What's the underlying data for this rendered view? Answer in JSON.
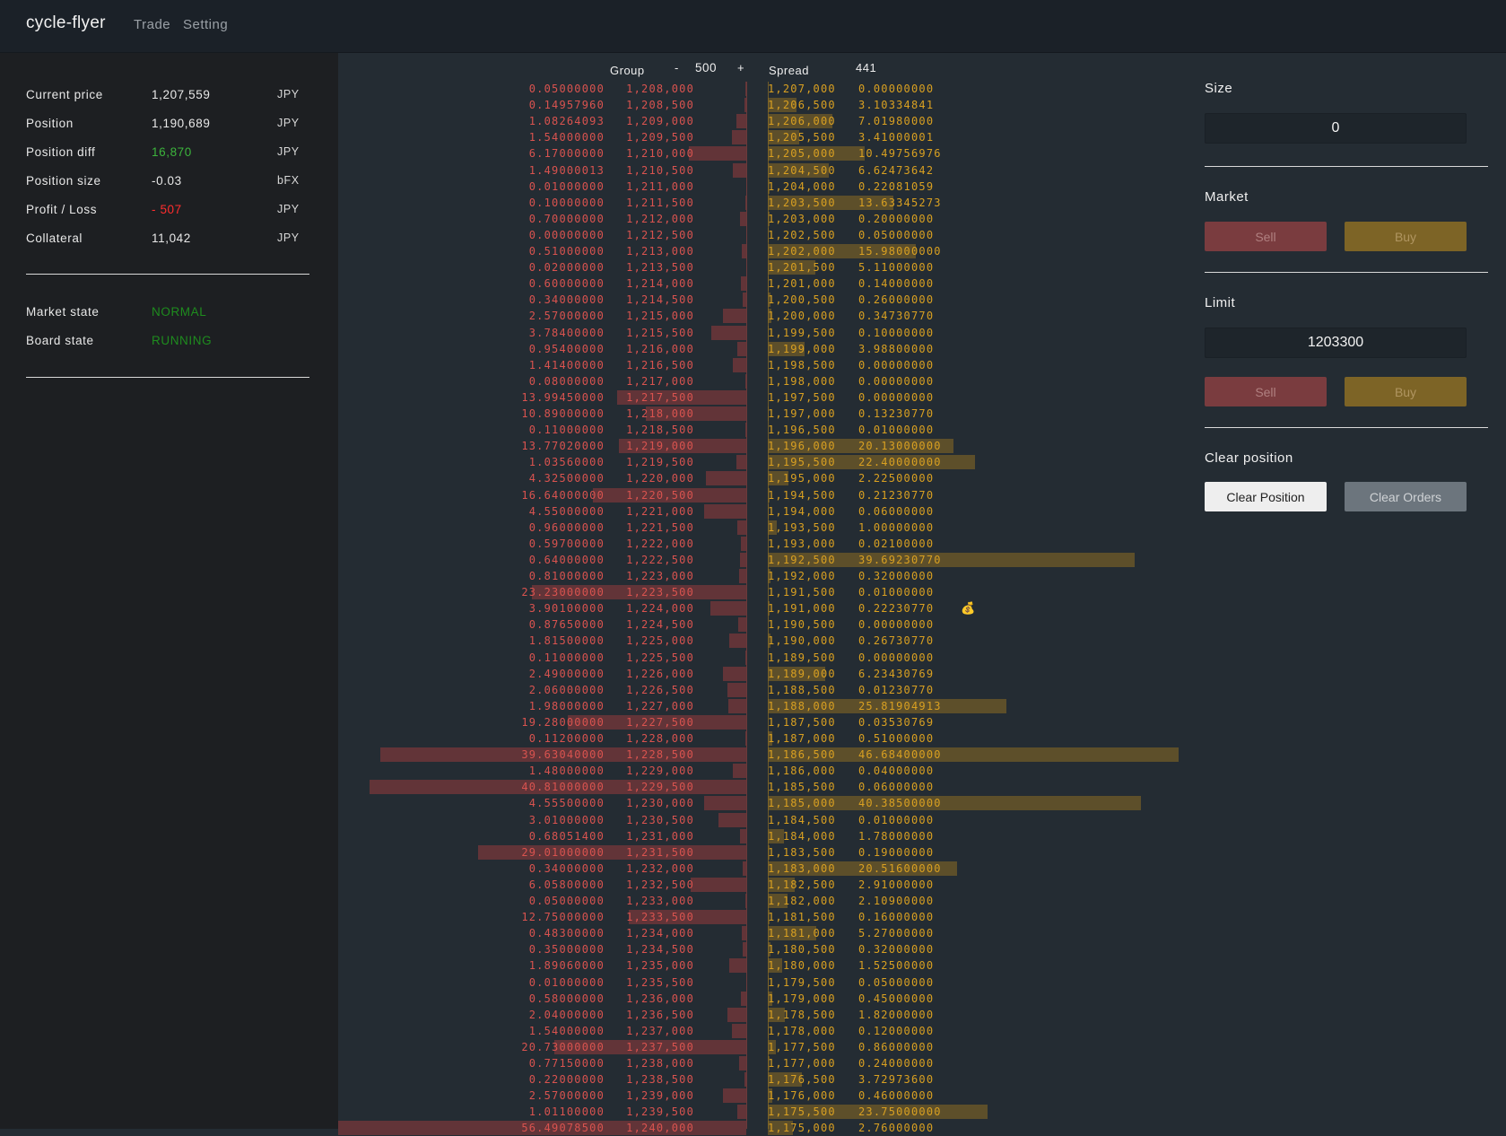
{
  "app": {
    "brand": "cycle-flyer",
    "nav": [
      "Trade",
      "Setting"
    ]
  },
  "colors": {
    "ask": "#d9534f",
    "bid": "#d9a021",
    "positive": "#3cb43c",
    "negative": "#ff2d2d"
  },
  "summary": [
    {
      "label": "Current price",
      "value": "1,207,559",
      "unit": "JPY"
    },
    {
      "label": "Position",
      "value": "1,190,689",
      "unit": "JPY"
    },
    {
      "label": "Position diff",
      "value": "16,870",
      "unit": "JPY",
      "tone": "positive"
    },
    {
      "label": "Position size",
      "value": "-0.03",
      "unit": "bFX"
    },
    {
      "label": "Profit / Loss",
      "value": "- 507",
      "unit": "JPY",
      "tone": "negative"
    },
    {
      "label": "Collateral",
      "value": "11,042",
      "unit": "JPY"
    }
  ],
  "states": [
    {
      "label": "Market state",
      "value": "NORMAL"
    },
    {
      "label": "Board state",
      "value": "RUNNING"
    }
  ],
  "board": {
    "group_label": "Group",
    "minus": "-",
    "group_value": "500",
    "plus": "+",
    "spread_label": "Spread",
    "spread_value": "441",
    "position_marker_icon": "money-bag-icon",
    "position_marker_glyph": "💰",
    "asks": [
      {
        "size": "0.05000000",
        "price": "1,208,000"
      },
      {
        "size": "0.14957960",
        "price": "1,208,500"
      },
      {
        "size": "1.08264093",
        "price": "1,209,000"
      },
      {
        "size": "1.54000000",
        "price": "1,209,500"
      },
      {
        "size": "6.17000000",
        "price": "1,210,000"
      },
      {
        "size": "1.49000013",
        "price": "1,210,500"
      },
      {
        "size": "0.01000000",
        "price": "1,211,000"
      },
      {
        "size": "0.10000000",
        "price": "1,211,500"
      },
      {
        "size": "0.70000000",
        "price": "1,212,000"
      },
      {
        "size": "0.00000000",
        "price": "1,212,500"
      },
      {
        "size": "0.51000000",
        "price": "1,213,000"
      },
      {
        "size": "0.02000000",
        "price": "1,213,500"
      },
      {
        "size": "0.60000000",
        "price": "1,214,000"
      },
      {
        "size": "0.34000000",
        "price": "1,214,500"
      },
      {
        "size": "2.57000000",
        "price": "1,215,000"
      },
      {
        "size": "3.78400000",
        "price": "1,215,500"
      },
      {
        "size": "0.95400000",
        "price": "1,216,000"
      },
      {
        "size": "1.41400000",
        "price": "1,216,500"
      },
      {
        "size": "0.08000000",
        "price": "1,217,000"
      },
      {
        "size": "13.99450000",
        "price": "1,217,500"
      },
      {
        "size": "10.89000000",
        "price": "1,218,000"
      },
      {
        "size": "0.11000000",
        "price": "1,218,500"
      },
      {
        "size": "13.77020000",
        "price": "1,219,000"
      },
      {
        "size": "1.03560000",
        "price": "1,219,500"
      },
      {
        "size": "4.32500000",
        "price": "1,220,000"
      },
      {
        "size": "16.64000000",
        "price": "1,220,500"
      },
      {
        "size": "4.55000000",
        "price": "1,221,000"
      },
      {
        "size": "0.96000000",
        "price": "1,221,500"
      },
      {
        "size": "0.59700000",
        "price": "1,222,000"
      },
      {
        "size": "0.64000000",
        "price": "1,222,500"
      },
      {
        "size": "0.81000000",
        "price": "1,223,000"
      },
      {
        "size": "23.23000000",
        "price": "1,223,500"
      },
      {
        "size": "3.90100000",
        "price": "1,224,000"
      },
      {
        "size": "0.87650000",
        "price": "1,224,500"
      },
      {
        "size": "1.81500000",
        "price": "1,225,000"
      },
      {
        "size": "0.11000000",
        "price": "1,225,500"
      },
      {
        "size": "2.49000000",
        "price": "1,226,000"
      },
      {
        "size": "2.06000000",
        "price": "1,226,500"
      },
      {
        "size": "1.98000000",
        "price": "1,227,000"
      },
      {
        "size": "19.28000000",
        "price": "1,227,500"
      },
      {
        "size": "0.11200000",
        "price": "1,228,000"
      },
      {
        "size": "39.63040000",
        "price": "1,228,500"
      },
      {
        "size": "1.48000000",
        "price": "1,229,000"
      },
      {
        "size": "40.81000000",
        "price": "1,229,500"
      },
      {
        "size": "4.55500000",
        "price": "1,230,000"
      },
      {
        "size": "3.01000000",
        "price": "1,230,500"
      },
      {
        "size": "0.68051400",
        "price": "1,231,000"
      },
      {
        "size": "29.01000000",
        "price": "1,231,500"
      },
      {
        "size": "0.34000000",
        "price": "1,232,000"
      },
      {
        "size": "6.05800000",
        "price": "1,232,500"
      },
      {
        "size": "0.05000000",
        "price": "1,233,000"
      },
      {
        "size": "12.75000000",
        "price": "1,233,500"
      },
      {
        "size": "0.48300000",
        "price": "1,234,000"
      },
      {
        "size": "0.35000000",
        "price": "1,234,500"
      },
      {
        "size": "1.89060000",
        "price": "1,235,000"
      },
      {
        "size": "0.01000000",
        "price": "1,235,500"
      },
      {
        "size": "0.58000000",
        "price": "1,236,000"
      },
      {
        "size": "2.04000000",
        "price": "1,236,500"
      },
      {
        "size": "1.54000000",
        "price": "1,237,000"
      },
      {
        "size": "20.73000000",
        "price": "1,237,500"
      },
      {
        "size": "0.77150000",
        "price": "1,238,000"
      },
      {
        "size": "0.22000000",
        "price": "1,238,500"
      },
      {
        "size": "2.57000000",
        "price": "1,239,000"
      },
      {
        "size": "1.01100000",
        "price": "1,239,500"
      },
      {
        "size": "56.49078500",
        "price": "1,240,000"
      }
    ],
    "bids": [
      {
        "price": "1,207,000",
        "size": "0.00000000"
      },
      {
        "price": "1,206,500",
        "size": "3.10334841"
      },
      {
        "price": "1,206,000",
        "size": "7.01980000"
      },
      {
        "price": "1,205,500",
        "size": "3.41000001"
      },
      {
        "price": "1,205,000",
        "size": "10.49756976"
      },
      {
        "price": "1,204,500",
        "size": "6.62473642"
      },
      {
        "price": "1,204,000",
        "size": "0.22081059"
      },
      {
        "price": "1,203,500",
        "size": "13.63345273"
      },
      {
        "price": "1,203,000",
        "size": "0.20000000"
      },
      {
        "price": "1,202,500",
        "size": "0.05000000"
      },
      {
        "price": "1,202,000",
        "size": "15.98000000"
      },
      {
        "price": "1,201,500",
        "size": "5.11000000"
      },
      {
        "price": "1,201,000",
        "size": "0.14000000"
      },
      {
        "price": "1,200,500",
        "size": "0.26000000"
      },
      {
        "price": "1,200,000",
        "size": "0.34730770"
      },
      {
        "price": "1,199,500",
        "size": "0.10000000"
      },
      {
        "price": "1,199,000",
        "size": "3.98800000"
      },
      {
        "price": "1,198,500",
        "size": "0.00000000"
      },
      {
        "price": "1,198,000",
        "size": "0.00000000"
      },
      {
        "price": "1,197,500",
        "size": "0.00000000"
      },
      {
        "price": "1,197,000",
        "size": "0.13230770"
      },
      {
        "price": "1,196,500",
        "size": "0.01000000"
      },
      {
        "price": "1,196,000",
        "size": "20.13000000"
      },
      {
        "price": "1,195,500",
        "size": "22.40000000"
      },
      {
        "price": "1,195,000",
        "size": "2.22500000"
      },
      {
        "price": "1,194,500",
        "size": "0.21230770"
      },
      {
        "price": "1,194,000",
        "size": "0.06000000"
      },
      {
        "price": "1,193,500",
        "size": "1.00000000"
      },
      {
        "price": "1,193,000",
        "size": "0.02100000"
      },
      {
        "price": "1,192,500",
        "size": "39.69230770"
      },
      {
        "price": "1,192,000",
        "size": "0.32000000"
      },
      {
        "price": "1,191,500",
        "size": "0.01000000"
      },
      {
        "price": "1,191,000",
        "size": "0.22230770",
        "marker": true
      },
      {
        "price": "1,190,500",
        "size": "0.00000000"
      },
      {
        "price": "1,190,000",
        "size": "0.26730770"
      },
      {
        "price": "1,189,500",
        "size": "0.00000000"
      },
      {
        "price": "1,189,000",
        "size": "6.23430769"
      },
      {
        "price": "1,188,500",
        "size": "0.01230770"
      },
      {
        "price": "1,188,000",
        "size": "25.81904913"
      },
      {
        "price": "1,187,500",
        "size": "0.03530769"
      },
      {
        "price": "1,187,000",
        "size": "0.51000000"
      },
      {
        "price": "1,186,500",
        "size": "46.68400000"
      },
      {
        "price": "1,186,000",
        "size": "0.04000000"
      },
      {
        "price": "1,185,500",
        "size": "0.06000000"
      },
      {
        "price": "1,185,000",
        "size": "40.38500000"
      },
      {
        "price": "1,184,500",
        "size": "0.01000000"
      },
      {
        "price": "1,184,000",
        "size": "1.78000000"
      },
      {
        "price": "1,183,500",
        "size": "0.19000000"
      },
      {
        "price": "1,183,000",
        "size": "20.51600000"
      },
      {
        "price": "1,182,500",
        "size": "2.91000000"
      },
      {
        "price": "1,182,000",
        "size": "2.10900000"
      },
      {
        "price": "1,181,500",
        "size": "0.16000000"
      },
      {
        "price": "1,181,000",
        "size": "5.27000000"
      },
      {
        "price": "1,180,500",
        "size": "0.32000000"
      },
      {
        "price": "1,180,000",
        "size": "1.52500000"
      },
      {
        "price": "1,179,500",
        "size": "0.05000000"
      },
      {
        "price": "1,179,000",
        "size": "0.45000000"
      },
      {
        "price": "1,178,500",
        "size": "1.82000000"
      },
      {
        "price": "1,178,000",
        "size": "0.12000000"
      },
      {
        "price": "1,177,500",
        "size": "0.86000000"
      },
      {
        "price": "1,177,000",
        "size": "0.24000000"
      },
      {
        "price": "1,176,500",
        "size": "3.72973600"
      },
      {
        "price": "1,176,000",
        "size": "0.46000000"
      },
      {
        "price": "1,175,500",
        "size": "23.75000000"
      },
      {
        "price": "1,175,000",
        "size": "2.76000000"
      }
    ]
  },
  "panel": {
    "size_label": "Size",
    "size_value": "0",
    "market_label": "Market",
    "limit_label": "Limit",
    "limit_value": "1203300",
    "sell_label": "Sell",
    "buy_label": "Buy",
    "clear_label": "Clear position",
    "clear_position_btn": "Clear Position",
    "clear_orders_btn": "Clear Orders"
  }
}
